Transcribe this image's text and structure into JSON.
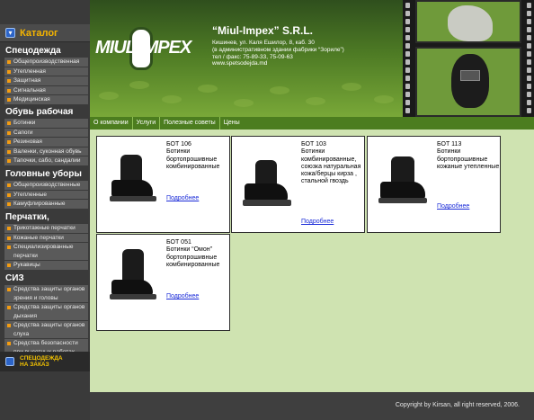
{
  "sidebar": {
    "catalog_title": "Каталог",
    "sections": [
      {
        "title": "Спецодежда",
        "items": [
          "Общепроизводственная",
          "Утепленная",
          "Защитная",
          "Сигнальная",
          "Медицинская"
        ]
      },
      {
        "title": "Обувь рабочая",
        "items": [
          "Ботинки",
          "Сапоги",
          "Резиновая",
          "Валенки, суконная обувь",
          "Тапочки, сабо, сандалии"
        ]
      },
      {
        "title": "Головные уборы",
        "items": [
          "Общепроизводственные",
          "Утепленные",
          "Камуфлированные"
        ]
      },
      {
        "title": "Перчатки, Рукавицы",
        "items": [
          "Трикотажные перчатки",
          "Кожаные перчатки",
          "Специализированные перчатки",
          "Рукавицы"
        ]
      },
      {
        "title": "СИЗ",
        "items": [
          "Средства защиты органов зрения и головы",
          "Средства защиты органов дыхания",
          "Средства защиты органов слуха",
          "Средства безопасности при высотных работах"
        ]
      }
    ],
    "order": {
      "line1": "СПЕЦОДЕЖДА",
      "line2": "НА ЗАКАЗ"
    }
  },
  "header": {
    "logo_text": "MIUL IMPEX",
    "company": "“Miul-Impex” S.R.L.",
    "address_lines": [
      "Кишинев, ул. Каля Ешилор, 8, каб. 30",
      "(в административном здании фабрики “Зориле”)",
      "тел / факс: 75-89-33, 75-09-63",
      "www.spetsodejda.md"
    ]
  },
  "nav": [
    "О компании",
    "Услуги",
    "Полезные советы",
    "Цены"
  ],
  "products": [
    {
      "code": "БОТ 106",
      "desc": "Ботинки бортопрошивные комбинированные",
      "link": "Подробнее"
    },
    {
      "code": "БОТ 103",
      "desc": "Ботинки комбинированные, союзка натуральная кожа/берцы кирза , стальной гвоздь",
      "link": "Подробнее"
    },
    {
      "code": "БОТ 113",
      "desc": "Ботинки бортопрошивные кожаные утепленные",
      "link": "Подробнее"
    },
    {
      "code": "БОТ 051",
      "desc": "Ботинки “Омон” бортопрошивные комбинированные",
      "link": "Подробнее"
    }
  ],
  "footer": {
    "copyright": "Copyright by Kirsan, all right reserved, 2006."
  }
}
